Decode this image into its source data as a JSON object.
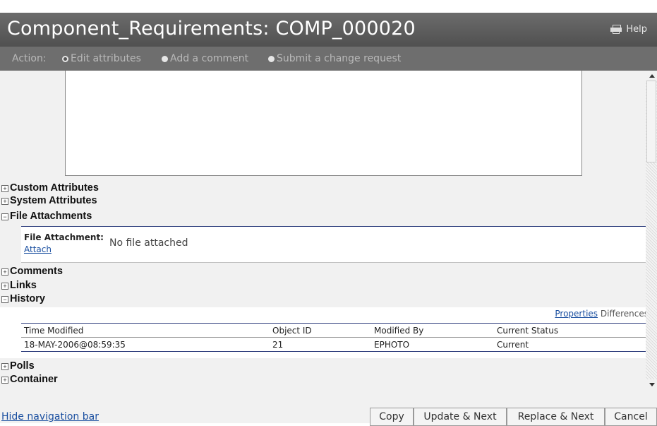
{
  "window": {
    "title": "Component_Requirements: COMP_000020",
    "help_label": "Help"
  },
  "action_bar": {
    "label": "Action:",
    "options": [
      {
        "label": "Edit attributes",
        "selected": true
      },
      {
        "label": "Add a comment",
        "selected": false
      },
      {
        "label": "Submit a change request",
        "selected": false
      }
    ]
  },
  "sections": {
    "custom_attributes": {
      "label": "Custom Attributes",
      "expanded": false
    },
    "system_attributes": {
      "label": "System Attributes",
      "expanded": false
    },
    "file_attachments": {
      "label": "File Attachments",
      "expanded": true
    },
    "comments": {
      "label": "Comments",
      "expanded": false
    },
    "links": {
      "label": "Links",
      "expanded": false
    },
    "history": {
      "label": "History",
      "expanded": true
    },
    "polls": {
      "label": "Polls",
      "expanded": false
    },
    "container": {
      "label": "Container",
      "expanded": false
    }
  },
  "attachment": {
    "label": "File Attachment:",
    "attach_link": "Attach",
    "value": "No file attached"
  },
  "history": {
    "properties_link": "Properties",
    "differences_label": "Differences",
    "columns": [
      "Time Modified",
      "Object ID",
      "Modified By",
      "Current Status"
    ],
    "rows": [
      [
        "18-MAY-2006@08:59:35",
        "21",
        "EPHOTO",
        "Current"
      ]
    ]
  },
  "footer": {
    "hide_nav_link": "Hide navigation bar",
    "buttons": {
      "copy": "Copy",
      "update_next": "Update & Next",
      "replace_next": "Replace & Next",
      "cancel": "Cancel"
    }
  },
  "colors": {
    "title_bg": "#5c5c5c",
    "action_bg": "#6e6e6e",
    "content_bg": "#f1f1f1",
    "link": "#1a4fa0",
    "rule": "#2a3a7a"
  }
}
